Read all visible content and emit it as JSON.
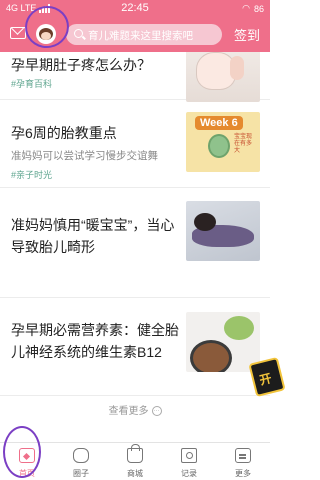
{
  "status_bar": {
    "network": "4G LTE",
    "time": "22:45",
    "battery": "86"
  },
  "header": {
    "search_placeholder": "育儿难题来这里搜索吧",
    "sign_in_label": "签到"
  },
  "articles": [
    {
      "title": "孕早期肚子疼怎么办？",
      "subtitle": "",
      "tag": "#孕育百科"
    },
    {
      "title": "孕6周的胎教重点",
      "subtitle": "准妈妈可以尝试学习慢步交谊舞",
      "tag": "#亲子时光",
      "thumb_badge": "Week 6",
      "thumb_caption": "宝宝现在有多大"
    },
    {
      "title": "准妈妈慎用“暖宝宝”，当心导致胎儿畸形",
      "subtitle": "",
      "tag": ""
    },
    {
      "title": "孕早期必需营养素：健全胎儿神经系统的维生素B12",
      "subtitle": "",
      "tag": ""
    }
  ],
  "see_more_label": "查看更多",
  "side_badge_label": "开",
  "tab_bar": [
    {
      "label": "首页",
      "icon": "home-icon",
      "active": true
    },
    {
      "label": "圈子",
      "icon": "community-icon",
      "active": false
    },
    {
      "label": "商城",
      "icon": "shop-icon",
      "active": false
    },
    {
      "label": "记录",
      "icon": "record-icon",
      "active": false
    },
    {
      "label": "更多",
      "icon": "more-icon",
      "active": false
    }
  ],
  "colors": {
    "brand": "#ef6f8a",
    "tag": "#5fa58f",
    "annotation": "#7b3fc4"
  }
}
